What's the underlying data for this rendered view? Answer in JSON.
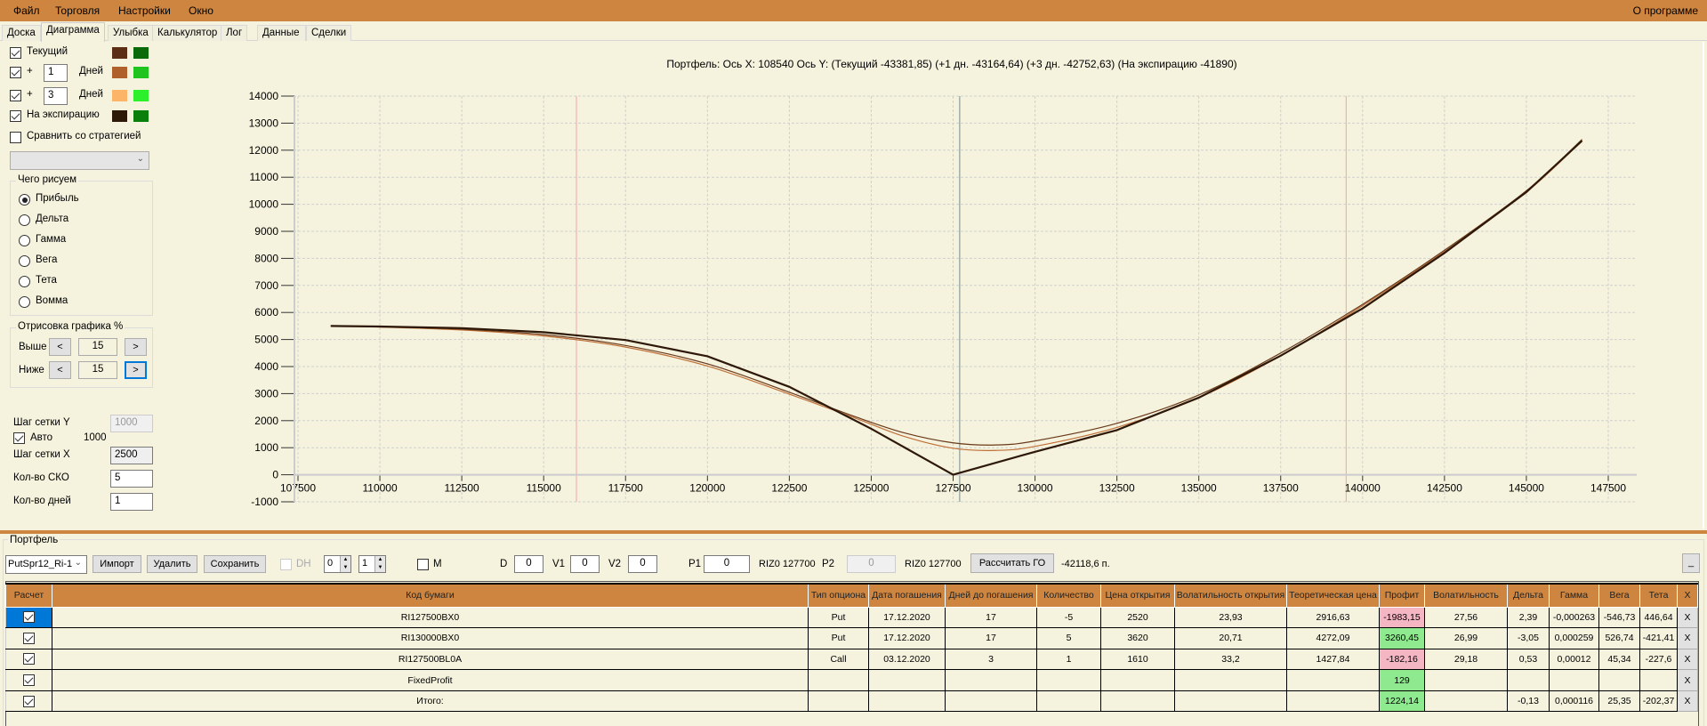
{
  "menu": {
    "items": [
      "Файл",
      "Торговля",
      "Настройки",
      "Окно"
    ],
    "about": "О программе"
  },
  "tabs": [
    "Доска",
    "Диаграмма",
    "Улыбка",
    "Калькулятор",
    "Лог",
    "Данные",
    "Сделки"
  ],
  "active_tab": "Диаграмма",
  "left_panel": {
    "current_label": "Текущий",
    "plus": "+",
    "days_label": "Дней",
    "plus1_value": "1",
    "plus3_value": "3",
    "expiration_label": "На экспирацию",
    "compare_label": "Сравнить со стратегией",
    "colors": {
      "current": [
        "#5C2E14",
        "#0A6A0A"
      ],
      "plus1": [
        "#B0602A",
        "#1FC41F"
      ],
      "plus3": [
        "#FCB468",
        "#2CF02C"
      ],
      "expiration": [
        "#2E1808",
        "#0B7F0B"
      ]
    },
    "draw_group_title": "Чего рисуем",
    "draw_options": [
      "Прибыль",
      "Дельта",
      "Гамма",
      "Вега",
      "Тета",
      "Вомма"
    ],
    "draw_selected": "Прибыль",
    "render_group_title": "Отрисовка графика %",
    "above_label": "Выше",
    "below_label": "Ниже",
    "above_value": "15",
    "below_value": "15",
    "prev_label": "<",
    "next_label": ">",
    "grid_y_label": "Шаг сетки Y",
    "grid_y_value": "1000",
    "auto_label": "Авто",
    "auto_value": "1000",
    "grid_x_label": "Шаг сетки X",
    "grid_x_value": "2500",
    "sko_label": "Кол-во СКО",
    "sko_value": "5",
    "days_count_label": "Кол-во дней",
    "days_count_value": "1"
  },
  "chart_data": {
    "type": "line",
    "title": "Портфель: Ось X:  108540 Ось Y:  (Текущий -43381,85)  (+1 дн. -43164,64)  (+3 дн. -42752,63)  (На экспирацию -41890)",
    "xlim": [
      107500,
      147500
    ],
    "ylim": [
      -1000,
      14000
    ],
    "x_ticks": [
      107500,
      110000,
      112500,
      115000,
      117500,
      120000,
      122500,
      125000,
      127500,
      130000,
      132500,
      135000,
      137500,
      140000,
      142500,
      145000,
      147500
    ],
    "y_ticks": [
      -1000,
      0,
      1000,
      2000,
      3000,
      4000,
      5000,
      6000,
      7000,
      8000,
      9000,
      10000,
      11000,
      12000,
      13000,
      14000
    ],
    "grid": true,
    "vlines": [
      {
        "name": "sigma-low",
        "x": 116000,
        "color": "#F4B0B0"
      },
      {
        "name": "current-price",
        "x": 127700,
        "color": "#8A9A9A"
      },
      {
        "name": "sigma-high",
        "x": 139500,
        "color": "#F4B0B0"
      }
    ],
    "series": [
      {
        "name": "На экспирацию",
        "color": "#2E1808",
        "width": 2.2,
        "x": [
          108500,
          110000,
          112500,
          115000,
          117500,
          120000,
          122500,
          125000,
          127500,
          130000,
          132500,
          135000,
          137500,
          140000,
          142500,
          145000,
          146700
        ],
        "y": [
          5500,
          5480,
          5420,
          5270,
          4980,
          4380,
          3250,
          1700,
          0,
          850,
          1650,
          2850,
          4400,
          6150,
          8200,
          10450,
          12350
        ]
      },
      {
        "name": "Текущий",
        "color": "#6A3A1A",
        "width": 1.2,
        "x": [
          108500,
          110000,
          112500,
          115000,
          117500,
          120000,
          122500,
          124500,
          126000,
          127500,
          128800,
          130000,
          132500,
          135000,
          137500,
          140000,
          142500,
          145000,
          146700
        ],
        "y": [
          5500,
          5470,
          5380,
          5180,
          4780,
          4100,
          3050,
          2150,
          1550,
          1180,
          1100,
          1250,
          1900,
          2950,
          4500,
          6300,
          8300,
          10500,
          12400
        ]
      },
      {
        "name": "+1 дн.",
        "color": "#C07038",
        "width": 1.2,
        "x": [
          108500,
          110000,
          112500,
          115000,
          117500,
          120000,
          122500,
          124500,
          126000,
          127500,
          128800,
          130000,
          132500,
          135000,
          137500,
          140000,
          142500,
          145000,
          146700
        ],
        "y": [
          5500,
          5460,
          5350,
          5130,
          4720,
          4020,
          2980,
          2100,
          1420,
          980,
          900,
          1050,
          1750,
          2850,
          4400,
          6250,
          8250,
          10450,
          12350
        ]
      }
    ]
  },
  "portfolio": {
    "title": "Портфель",
    "combo_value": "PutSpr12_Ri-1",
    "import_label": "Импорт",
    "delete_label": "Удалить",
    "save_label": "Сохранить",
    "dh_label": "DH",
    "spin1": "0",
    "spin2": "1",
    "m_label": "M",
    "d_label": "D",
    "d_value": "0",
    "v1_label": "V1",
    "v1_value": "0",
    "v2_label": "V2",
    "v2_value": "0",
    "p1_label": "P1",
    "p1_value": "0",
    "p1_instr": "RIZ0 127700",
    "p2_label": "P2",
    "p2_value": "0",
    "p2_instr": "RIZ0 127700",
    "calc_go_label": "Рассчитать ГО",
    "go_value": "-42118,6 п.",
    "minimize_label": "_"
  },
  "table": {
    "headers": [
      "Расчет",
      "Код бумаги",
      "Тип опциона",
      "Дата погашения",
      "Дней до погашения",
      "Количество",
      "Цена открытия",
      "Волатильность открытия",
      "Теоретическая цена",
      "Профит",
      "Волатильность",
      "Дельта",
      "Гамма",
      "Вега",
      "Тета",
      "X"
    ],
    "rows": [
      [
        "RI127500BX0",
        "Put",
        "17.12.2020",
        "17",
        "-5",
        "2520",
        "23,93",
        "2916,63",
        "-1983,15",
        "27,56",
        "2,39",
        "-0,000263",
        "-546,73",
        "446,64",
        "X"
      ],
      [
        "RI130000BX0",
        "Put",
        "17.12.2020",
        "17",
        "5",
        "3620",
        "20,71",
        "4272,09",
        "3260,45",
        "26,99",
        "-3,05",
        "0,000259",
        "526,74",
        "-421,41",
        "X"
      ],
      [
        "RI127500BL0A",
        "Call",
        "03.12.2020",
        "3",
        "1",
        "1610",
        "33,2",
        "1427,84",
        "-182,16",
        "29,18",
        "0,53",
        "0,00012",
        "45,34",
        "-227,6",
        "X"
      ],
      [
        "FixedProfit",
        "",
        "",
        "",
        "",
        "",
        "",
        "",
        "129",
        "",
        "",
        "",
        "",
        "",
        "X"
      ],
      [
        "Итого:",
        "",
        "",
        "",
        "",
        "",
        "",
        "",
        "1224,14",
        "",
        "-0,13",
        "0,000116",
        "25,35",
        "-202,37",
        "X"
      ]
    ],
    "profit_colors": {
      "negative": "#F4B6C2",
      "positive": "#8FEA8F"
    }
  }
}
